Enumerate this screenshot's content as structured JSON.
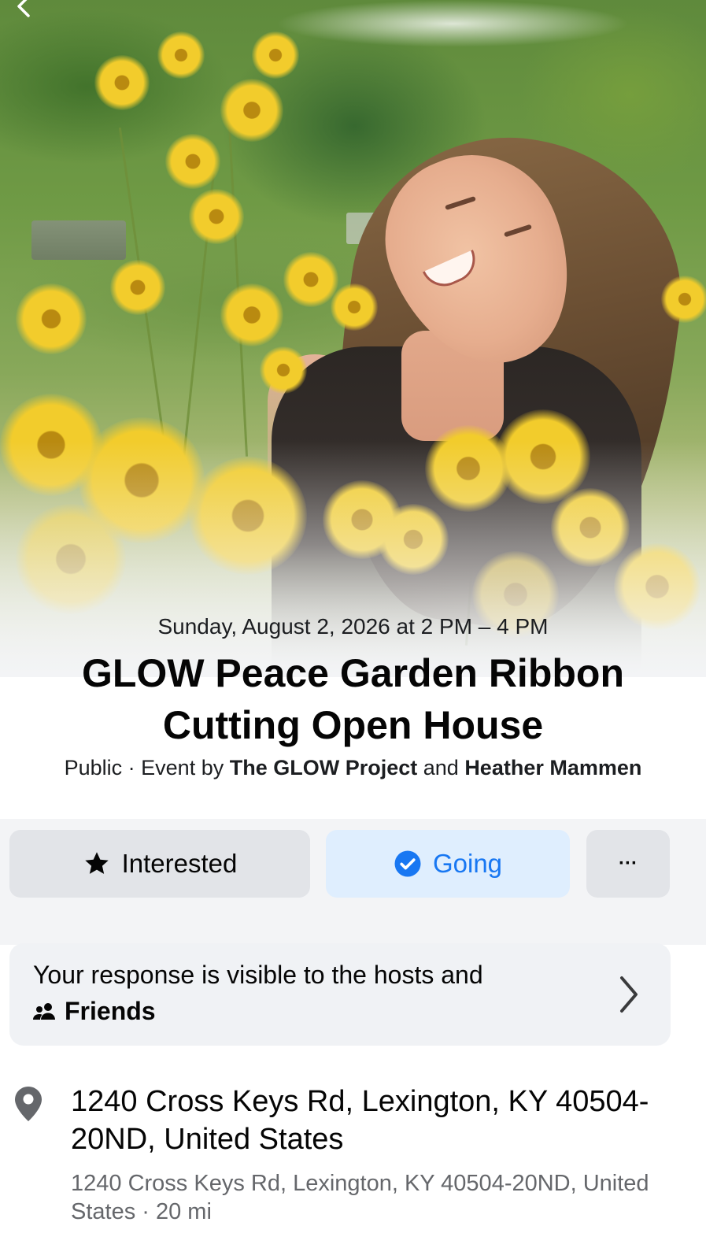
{
  "event": {
    "date_time": "Sunday, August 2, 2026 at 2 PM – 4 PM",
    "title": "GLOW Peace Garden Ribbon Cutting Open House",
    "privacy": "Public",
    "separator": " · ",
    "event_by": "Event by ",
    "host1": "The GLOW Project",
    "and": " and ",
    "host2": "Heather Mammen"
  },
  "actions": {
    "interested_label": "Interested",
    "going_label": "Going",
    "more_label": "···"
  },
  "visibility": {
    "line1": "Your response is visible to the hosts and",
    "audience": "Friends"
  },
  "location": {
    "address": "1240 Cross Keys Rd, Lexington, KY 40504-20ND, United States",
    "detail": "1240 Cross Keys Rd, Lexington, KY 40504-20ND, United States · 20 mi"
  },
  "icons": {
    "back": "chevron-left-icon",
    "interested": "star-icon",
    "going": "check-circle-icon",
    "more": "more-icon",
    "audience": "friends-icon",
    "open": "chevron-right-icon",
    "location": "pin-icon"
  },
  "colors": {
    "accent": "#1877f2",
    "going_bg": "#dfeefe",
    "button_bg": "#e2e4e8",
    "secondary_text": "#65676b"
  }
}
